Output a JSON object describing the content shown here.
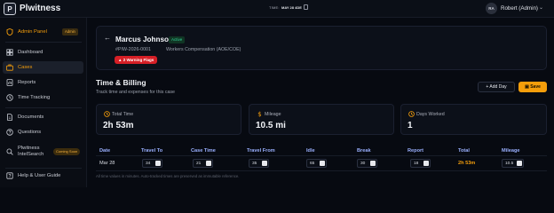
{
  "app": {
    "name": "Plwitness",
    "logo_letter": "P"
  },
  "topbar": {
    "time_label": "TIME:",
    "time_value": "MAY 28 4DE",
    "user_initials": "RA",
    "user_name": "Robert (Admin)"
  },
  "sidebar": {
    "admin_panel": {
      "label": "Admin Panel",
      "badge": "Admin"
    },
    "items": [
      {
        "label": "Dashboard",
        "icon": "dashboard-icon"
      },
      {
        "label": "Cases",
        "icon": "briefcase-icon",
        "active": true
      },
      {
        "label": "Reports",
        "icon": "chart-icon"
      },
      {
        "label": "Time Tracking",
        "icon": "clock-icon"
      },
      {
        "label": "Documents",
        "icon": "document-icon"
      },
      {
        "label": "Questions",
        "icon": "question-icon"
      },
      {
        "label": "Plwitness",
        "label2": "IntelSearch",
        "badge": "Coming Soon",
        "icon": "search-icon"
      }
    ],
    "help": {
      "label": "Help & User Guide",
      "icon": "help-icon"
    }
  },
  "case": {
    "name": "Marcus Johnson",
    "status": "Active",
    "id": "#PIW-2026-0001",
    "type": "Workers Compensation (AOE/COE)",
    "warnings": "2 Warning Flags"
  },
  "billing": {
    "title": "Time & Billing",
    "subtitle": "Track time and expenses for this case",
    "add_day_label": "+ Add Day",
    "save_label": "Save",
    "stats": {
      "total_time": {
        "label": "Total Time",
        "value": "2h 53m"
      },
      "mileage": {
        "label": "Mileage",
        "value": "10.5 mi"
      },
      "days_worked": {
        "label": "Days Worked",
        "value": "1"
      }
    },
    "columns": [
      "Date",
      "Travel To",
      "Case Time",
      "Travel From",
      "Idle",
      "Break",
      "Report",
      "Total",
      "Mileage"
    ],
    "row": {
      "date": "Mar 28",
      "travel_to": "34",
      "case_time": "21",
      "travel_from": "35",
      "idle": "65",
      "break": "30",
      "report": "18",
      "total": "2h 53m",
      "mileage": "10.5"
    },
    "footnote": "All time values in minutes. Auto-tracked times are preserved as immutable reference."
  },
  "colors": {
    "accent": "#f59e0b",
    "active": "#34d399",
    "danger": "#d61f26",
    "header": "#9ab0ff"
  }
}
